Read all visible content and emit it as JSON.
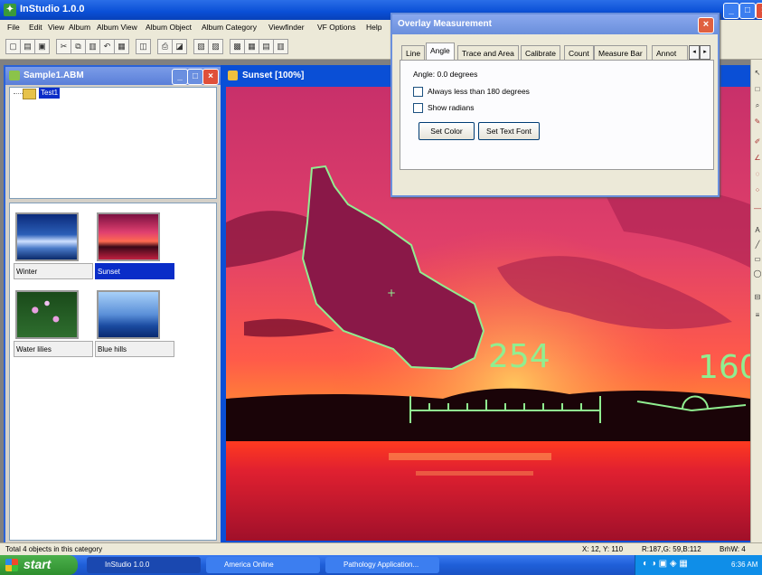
{
  "app": {
    "title": "InStudio 1.0.0",
    "window_buttons": {
      "minimize": "_",
      "maximize": "□",
      "close": "×"
    }
  },
  "menubar": [
    "File",
    "Edit",
    "View",
    "Album",
    "Album View",
    "Album Object",
    "Album Category",
    "Viewfinder",
    "VF Options",
    "Help"
  ],
  "album_window": {
    "title": "Sample1.ABM",
    "tree_items": [
      "Test1"
    ],
    "thumbnails": [
      {
        "label": "Winter",
        "selected": false
      },
      {
        "label": "Sunset",
        "selected": true
      },
      {
        "label": "Water lilies",
        "selected": false
      },
      {
        "label": "Blue hills",
        "selected": false
      }
    ]
  },
  "image_window": {
    "title": "Sunset [100%]",
    "annotations": {
      "measure_254": "254",
      "measure_160": "160"
    }
  },
  "overlay_dialog": {
    "title": "Overlay Measurement",
    "close_label": "×",
    "tabs": [
      "Line",
      "Angle",
      "Trace and Area",
      "Calibrate",
      "Count",
      "Measure Bar",
      "Annot"
    ],
    "active_tab": "Angle",
    "angle_text": "Angle: 0.0 degrees",
    "checkboxes": [
      {
        "label": "Always less than 180 degrees",
        "checked": false
      },
      {
        "label": "Show radians",
        "checked": false
      }
    ],
    "buttons": {
      "set_color": "Set Color",
      "set_text_font": "Set Text Font"
    },
    "scroll_left": "◂",
    "scroll_right": "▸"
  },
  "statusbar": {
    "left": "Total 4 objects in this category",
    "coords": "X: 12, Y: 110",
    "rgb": "R:187,G: 59,B:112",
    "brhw": "BrhW: 4"
  },
  "taskbar": {
    "start": "start",
    "tasks": [
      "InStudio 1.0.0",
      "America Online",
      "Pathology Application..."
    ],
    "clock": "6:36 AM"
  },
  "colors": {
    "measure_green": "#90ee90",
    "selection_blue": "#0a2dc8",
    "xp_blue": "#0a4fd6"
  }
}
